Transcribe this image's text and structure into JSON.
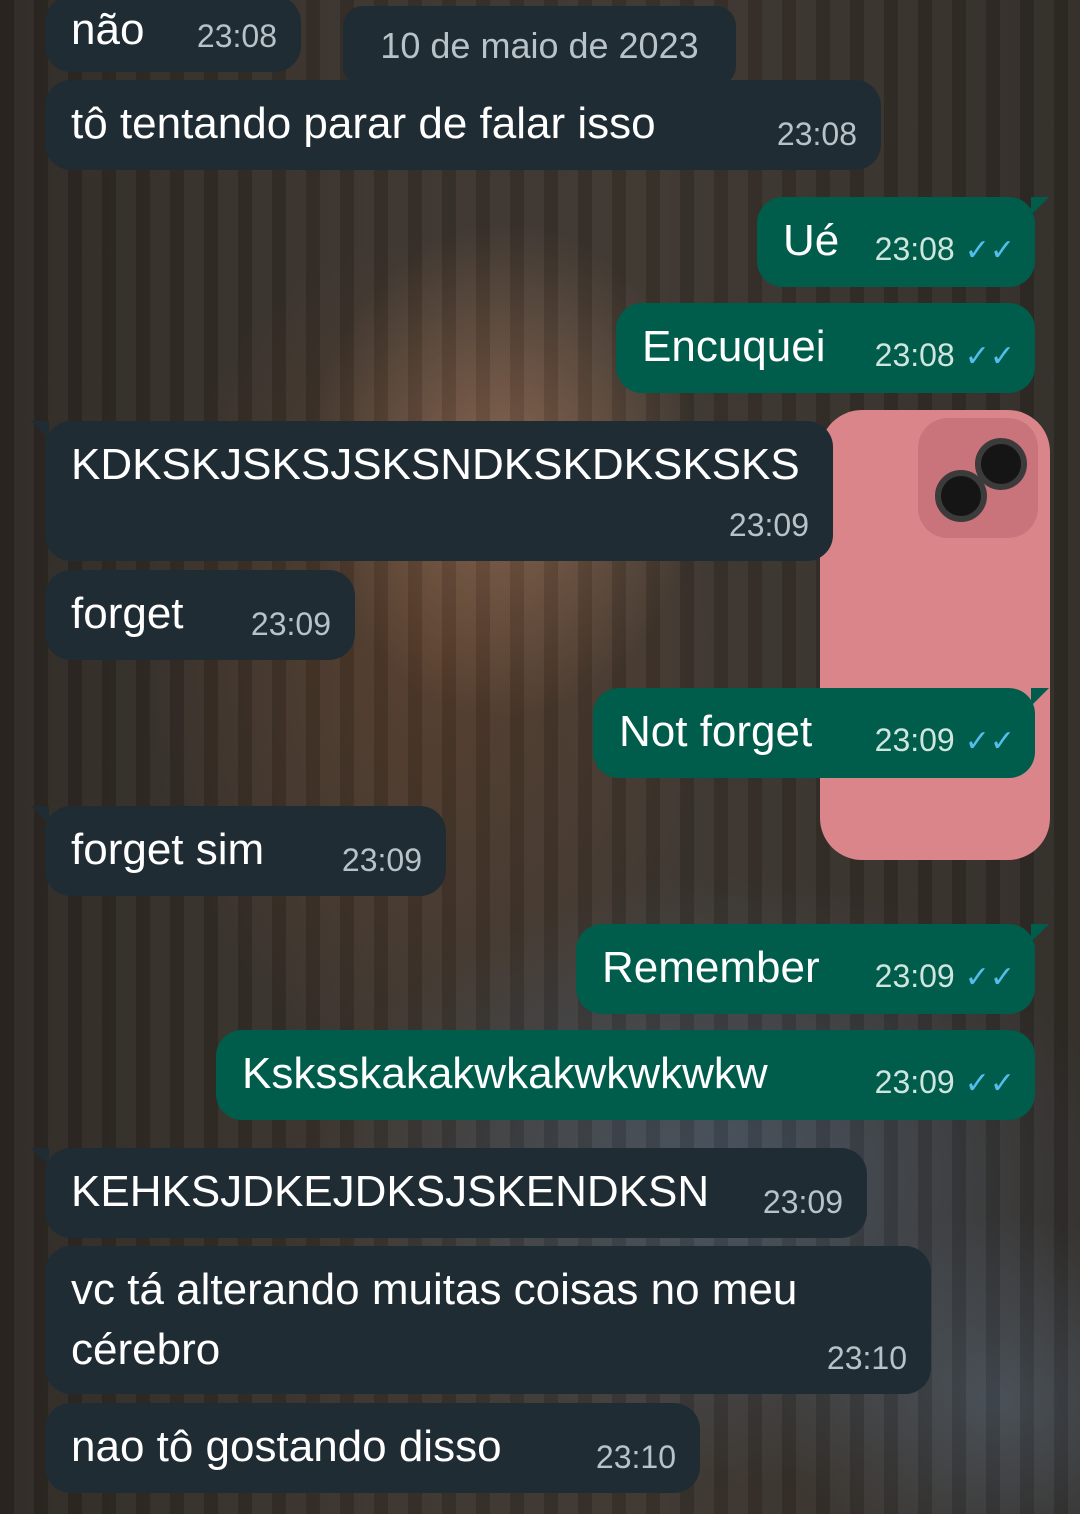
{
  "date_separator": "10 de maio de 2023",
  "messages": [
    {
      "text": "não",
      "time": "23:08",
      "direction": "in"
    },
    {
      "text": "tô tentando parar de falar isso",
      "time": "23:08",
      "direction": "in"
    },
    {
      "text": "Ué",
      "time": "23:08",
      "direction": "out",
      "ticks": "✓✓"
    },
    {
      "text": "Encuquei",
      "time": "23:08",
      "direction": "out",
      "ticks": "✓✓"
    },
    {
      "text": "KDKSKJSKSJSKSNDKSKDKSKSKS",
      "time": "23:09",
      "direction": "in"
    },
    {
      "text": "forget",
      "time": "23:09",
      "direction": "in"
    },
    {
      "text": "Not forget",
      "time": "23:09",
      "direction": "out",
      "ticks": "✓✓"
    },
    {
      "text": "forget sim",
      "time": "23:09",
      "direction": "in"
    },
    {
      "text": "Remember",
      "time": "23:09",
      "direction": "out",
      "ticks": "✓✓"
    },
    {
      "text": "Ksksskakakwkakwkwkwkw",
      "time": "23:09",
      "direction": "out",
      "ticks": "✓✓"
    },
    {
      "text": "KEHKSJDKEJDKSJSKENDKSN",
      "time": "23:09",
      "direction": "in"
    },
    {
      "text": "vc tá alterando muitas coisas no meu cérebro",
      "time": "23:10",
      "direction": "in"
    },
    {
      "text": "nao tô gostando disso",
      "time": "23:10",
      "direction": "in"
    }
  ],
  "colors": {
    "incoming_bubble": "#202c33",
    "outgoing_bubble": "#005c4b",
    "read_ticks": "#53bdeb"
  }
}
